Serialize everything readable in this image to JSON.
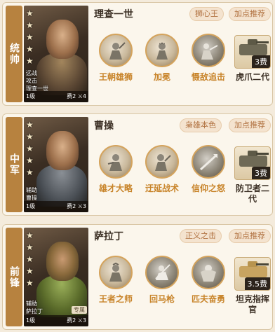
{
  "colors": {
    "accent": "#b7823f",
    "skill_text": "#c8842a",
    "badge_text": "#b0703f",
    "background": "#f4ebdc"
  },
  "generals": [
    {
      "position": "统帅",
      "name": "理查一世",
      "title_badge": "狮心王",
      "recommend": "加点推荐",
      "role_lines": [
        "远战",
        "攻击",
        "理查一世"
      ],
      "level": "1级",
      "cost": "费2",
      "count": "4",
      "skills": [
        {
          "label": "王朝雄狮",
          "icon": "lion-warrior-icon"
        },
        {
          "label": "加冕",
          "icon": "crown-warrior-icon"
        },
        {
          "label": "慑敌追击",
          "icon": "pursuit-icon"
        }
      ],
      "unit": {
        "label": "虎爪二代",
        "cost": "3费",
        "icon": "tank-icon"
      }
    },
    {
      "position": "中军",
      "name": "曹操",
      "title_badge": "枭雄本色",
      "recommend": "加点推荐",
      "role_lines": [
        "辅助",
        "曹操"
      ],
      "level": "1级",
      "cost": "费2",
      "count": "3",
      "skills": [
        {
          "label": "雄才大略",
          "icon": "strategist-icon"
        },
        {
          "label": "迂延战术",
          "icon": "tactics-icon"
        },
        {
          "label": "信仰之怒",
          "icon": "spear-icon"
        }
      ],
      "unit": {
        "label": "防卫者二代",
        "cost": "3费",
        "icon": "tank-icon"
      }
    },
    {
      "position": "前锋",
      "name": "萨拉丁",
      "title_badge": "正义之击",
      "recommend": "加点推荐",
      "role_lines": [
        "辅助",
        "萨拉丁"
      ],
      "extra_tag": "专属",
      "level": "1级",
      "cost": "费2",
      "count": "3",
      "skills": [
        {
          "label": "王者之师",
          "icon": "king-army-icon"
        },
        {
          "label": "回马枪",
          "icon": "horse-spear-icon"
        },
        {
          "label": "匹夫奋勇",
          "icon": "brave-icon"
        }
      ],
      "unit": {
        "label": "坦克指挥官",
        "cost": "3.5费",
        "icon": "tank-icon"
      }
    }
  ]
}
